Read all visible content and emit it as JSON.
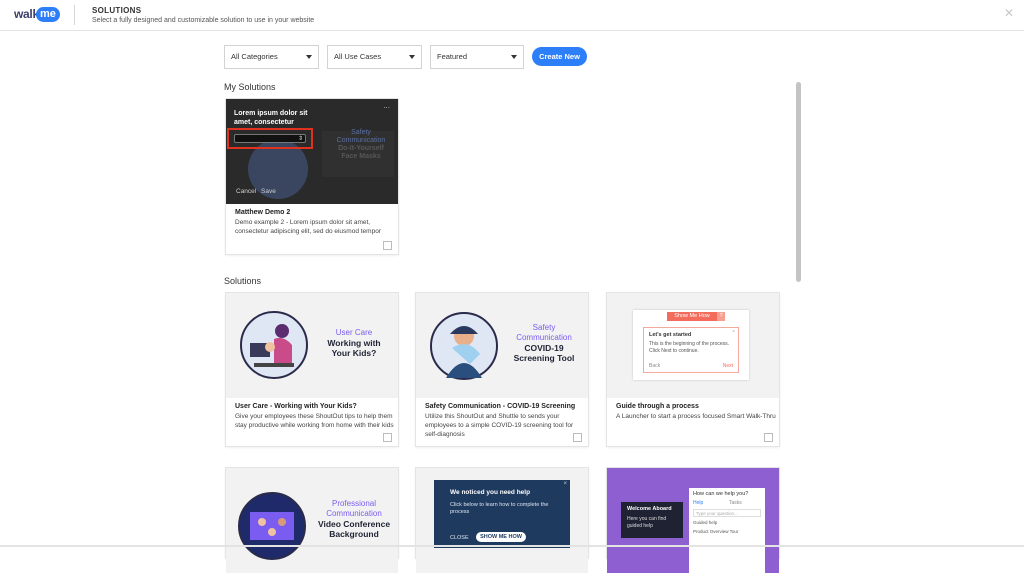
{
  "header": {
    "logo_walk": "walk",
    "logo_me": "me",
    "title": "SOLUTIONS",
    "subtitle": "Select a fully designed and customizable solution to use in your website",
    "close_icon": "close-icon"
  },
  "filters": {
    "categories": "All Categories",
    "use_cases": "All Use Cases",
    "sort": "Featured",
    "create_label": "Create New"
  },
  "my_solutions": {
    "heading": "My Solutions",
    "card": {
      "editor_title_line1": "Lorem ipsum dolor sit",
      "editor_title_line2": "amet, consectetur",
      "menu": "...",
      "bg_line1": "Safety",
      "bg_line2": "Communication",
      "bg_line3": "Do-It-Yourself",
      "bg_line4": "Face Masks",
      "cancel_label": "Cancel",
      "save_label": "Save",
      "title": "Matthew Demo 2",
      "desc": "Demo example 2 - Lorem ipsum dolor sit amet, consectetur adipiscing elit, sed do eiusmod tempor"
    }
  },
  "solutions": {
    "heading": "Solutions",
    "cards": [
      {
        "img_line1": "User Care",
        "img_line2": "Working with",
        "img_line3": "Your Kids?",
        "title": "User Care - Working with Your Kids?",
        "desc": "Give your employees these ShoutOut tips to help them stay productive while working from home with their kids"
      },
      {
        "img_line1": "Safety",
        "img_line2": "Communication",
        "img_line3": "COVID-19",
        "img_line4": "Screening Tool",
        "title": "Safety Communication - COVID-19 Screening",
        "desc": "Utilize this ShoutOut and Shuttle to sends your employees to a simple COVID-19 screening tool for self-diagnosis"
      },
      {
        "img_button": "Show Me How",
        "img_badge": "?",
        "img_popup_title": "Let's get started",
        "img_popup_body": "This is the beginning of the process. Click Next to continue.",
        "img_back": "Back",
        "img_next": "Next",
        "title": "Guide through a process",
        "desc": "A Launcher to start a process focused Smart Walk-Thru"
      },
      {
        "img_line1": "Professional",
        "img_line2": "Communication",
        "img_line3": "Video Conference",
        "img_line4": "Background"
      },
      {
        "img_title": "We noticed you need help",
        "img_body": "Click below to learn how to complete the process",
        "img_close": "CLOSE",
        "img_show": "SHOW ME HOW"
      },
      {
        "img_welcome": "Welcome Aboard",
        "img_welcome_body": "Here you can find guided help",
        "img_help_title": "How can we help you?",
        "img_tab1": "Help",
        "img_tab2": "Tasks",
        "img_search": "Type your question...",
        "img_item1": "Guided help",
        "img_item2": "Product Overview Tour"
      }
    ]
  },
  "colors": {
    "accent": "#2d7ff9",
    "dark_card": "#2a2a2a",
    "highlight": "#e0321f",
    "coral": "#f26b5b",
    "purple": "#7b5cf0",
    "navy": "#1f3a5f"
  }
}
